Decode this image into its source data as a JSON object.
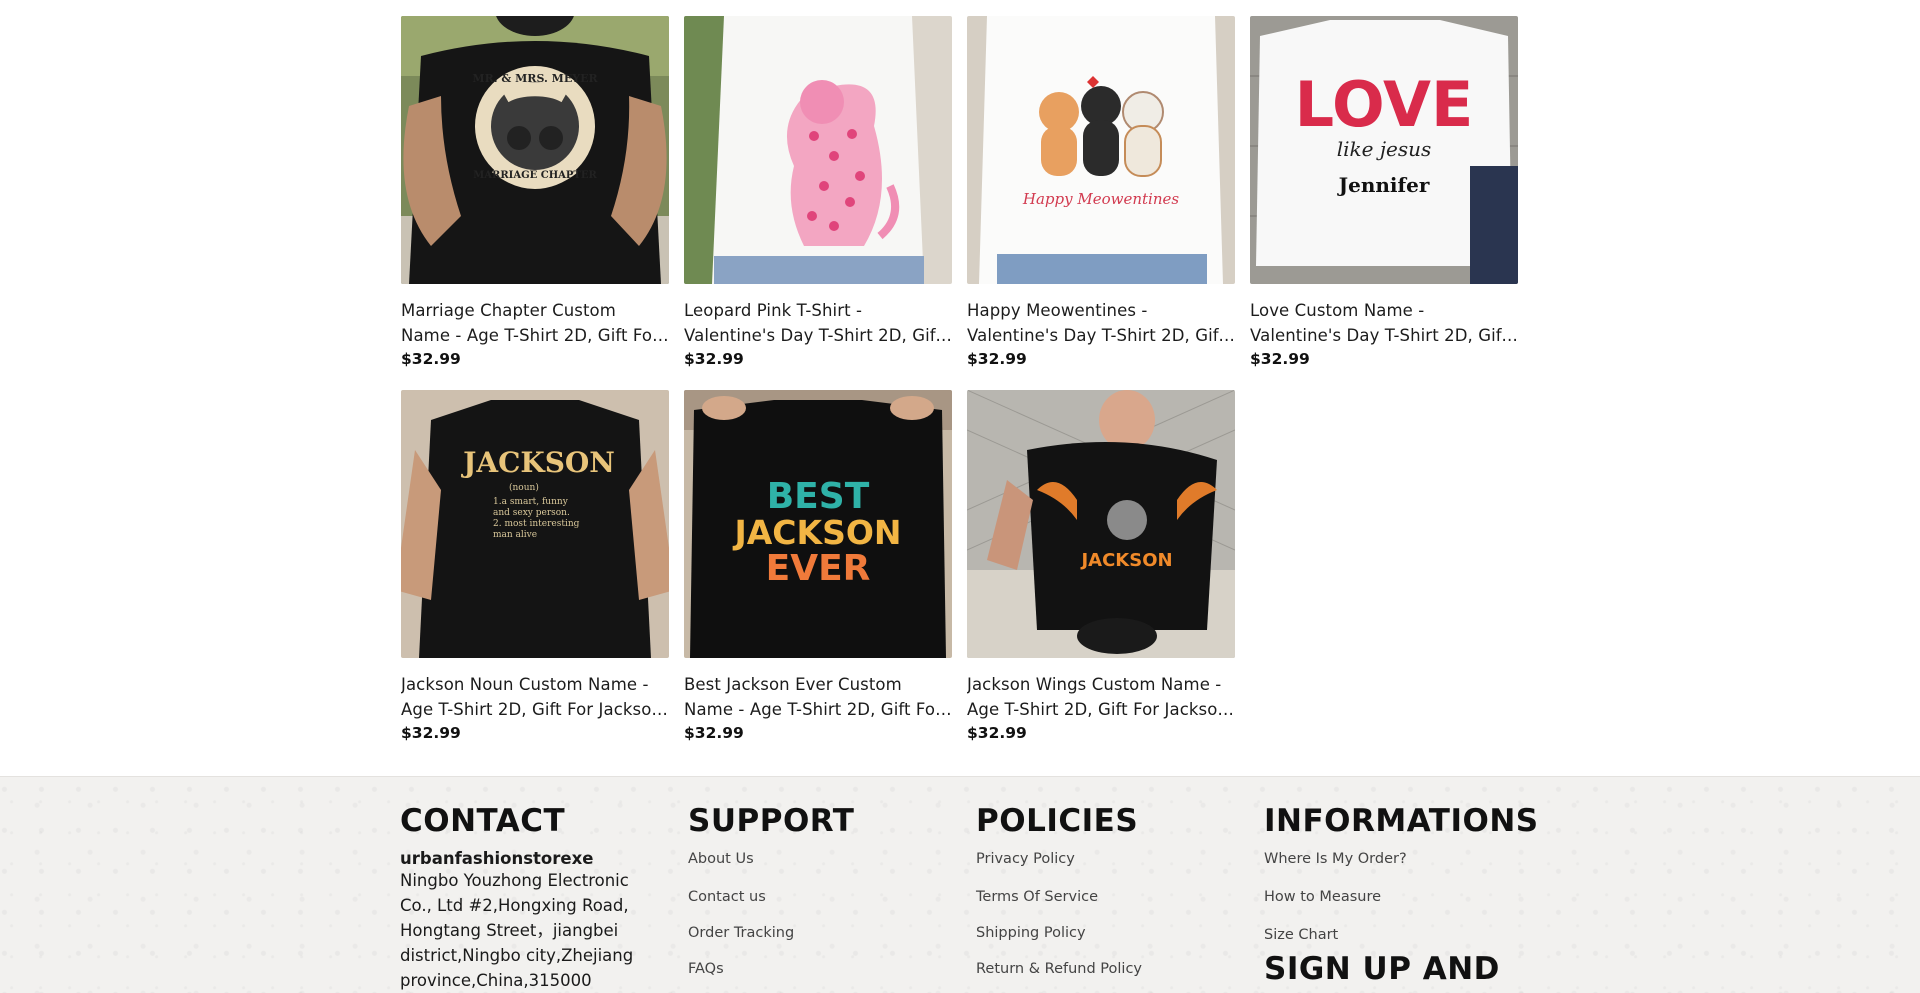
{
  "products": [
    {
      "title": "Marriage Chapter Custom Name - Age T-Shirt 2D, Gift For Couple, Biker Husband",
      "price": "$32.99",
      "image": "black tee with biker couple badge",
      "art": {
        "top": "MR. & MRS. MEYER",
        "bottom": "MARRIAGE CHAPTER"
      }
    },
    {
      "title": "Leopard Pink T-Shirt - Valentine's Day T-Shirt 2D, Gift For Couple, Lover",
      "price": "$32.99",
      "image": "white tee with pink heart leopard"
    },
    {
      "title": "Happy Meowentines - Valentine's Day T-Shirt 2D, Gift For Cat Lovers",
      "price": "$32.99",
      "image": "white tee with three cats",
      "art": {
        "caption": "Happy Meowentines"
      }
    },
    {
      "title": "Love Custom Name - Valentine's Day T-Shirt 2D, Gift For Couple, Christian",
      "price": "$32.99",
      "image": "white tee with LOVE like jesus",
      "art": {
        "big": "LOVE",
        "script": "like jesus",
        "name": "Jennifer"
      }
    },
    {
      "title": "Jackson Noun Custom Name - Age T-Shirt 2D, Gift For Jackson, Family",
      "price": "$32.99",
      "image": "black tee with Jackson noun definition",
      "art": {
        "name": "JACKSON",
        "noun": "(noun)",
        "lines": [
          "1.a smart, funny",
          "and sexy person.",
          "2. most interesting",
          "man alive"
        ]
      }
    },
    {
      "title": "Best Jackson Ever Custom Name - Age T-Shirt 2D, Gift For Jackson, Family",
      "price": "$32.99",
      "image": "black tee Best Jackson Ever",
      "art": {
        "l1": "BEST",
        "l2": "JACKSON",
        "l3": "EVER"
      }
    },
    {
      "title": "Jackson Wings Custom Name - Age T-Shirt 2D, Gift For Jackson, Biker",
      "price": "$32.99",
      "image": "black tee with winged skull",
      "art": {
        "name": "JACKSON"
      }
    }
  ],
  "footer": {
    "contact": {
      "heading": "CONTACT",
      "company": "urbanfashionstorexe",
      "address": "Ningbo Youzhong Electronic Co., Ltd #2,Hongxing Road, Hongtang Street，jiangbei district,Ningbo city,Zhejiang province,China,315000"
    },
    "support": {
      "heading": "SUPPORT",
      "links": [
        "About Us",
        "Contact us",
        "Order Tracking",
        "FAQs"
      ]
    },
    "policies": {
      "heading": "POLICIES",
      "links": [
        "Privacy Policy",
        "Terms Of Service",
        "Shipping Policy",
        "Return & Refund Policy"
      ]
    },
    "informations": {
      "heading": "INFORMATIONS",
      "links": [
        "Where Is My Order?",
        "How to Measure",
        "Size Chart"
      ]
    },
    "signup": "SIGN UP AND"
  }
}
